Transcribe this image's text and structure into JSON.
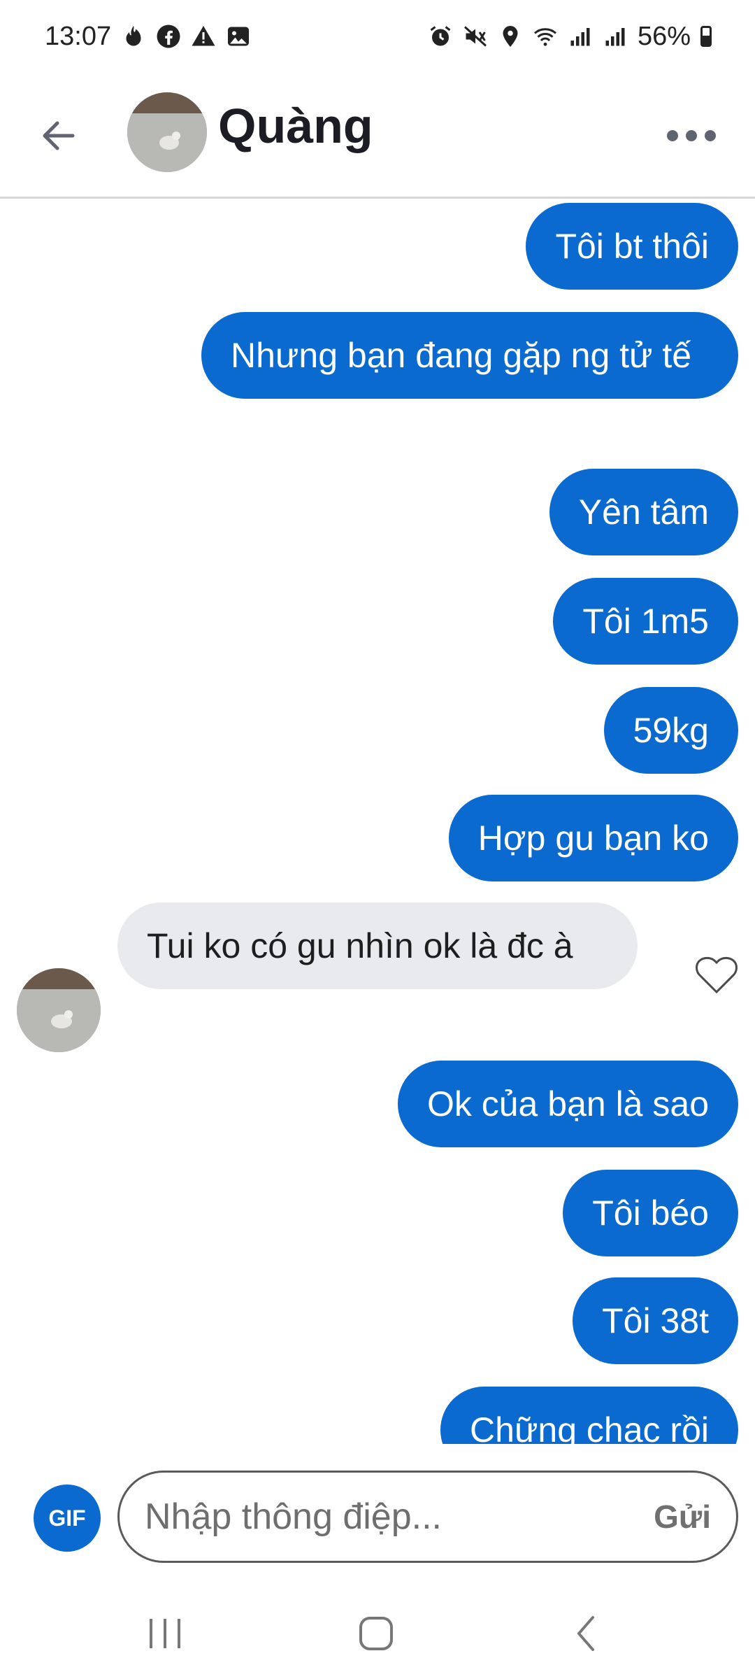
{
  "status_bar": {
    "time": "13:07",
    "battery": "56%",
    "left_icons": [
      "tinder-icon",
      "facebook-icon",
      "warning-icon",
      "image-icon"
    ],
    "right_icons": [
      "alarm-icon",
      "mute-icon",
      "location-icon",
      "wifi-icon",
      "signal-icon",
      "signal-icon",
      "battery-icon"
    ]
  },
  "header": {
    "title": "Quàng",
    "back_icon": "arrow-left-icon",
    "more_icon": "more-dots-icon"
  },
  "messages": [
    {
      "from": "me",
      "text": "Tôi bt thôi"
    },
    {
      "from": "me",
      "text": "Nhưng bạn đang gặp ng tử tế"
    },
    {
      "from": "me",
      "text": "Yên tâm"
    },
    {
      "from": "me",
      "text": "Tôi 1m5"
    },
    {
      "from": "me",
      "text": "59kg"
    },
    {
      "from": "me",
      "text": "Hợp gu bạn ko"
    },
    {
      "from": "them",
      "text": "Tui ko có gu nhìn ok là đc à"
    },
    {
      "from": "me",
      "text": "Ok của bạn là sao"
    },
    {
      "from": "me",
      "text": "Tôi béo"
    },
    {
      "from": "me",
      "text": "Tôi 38t"
    },
    {
      "from": "me",
      "text": "Chững chạc rồi"
    }
  ],
  "composer": {
    "gif_label": "GIF",
    "placeholder": "Nhập thông điệp...",
    "send_label": "Gửi"
  },
  "colors": {
    "accent": "#0a6ad0",
    "incoming_bubble": "#e9eaee"
  }
}
